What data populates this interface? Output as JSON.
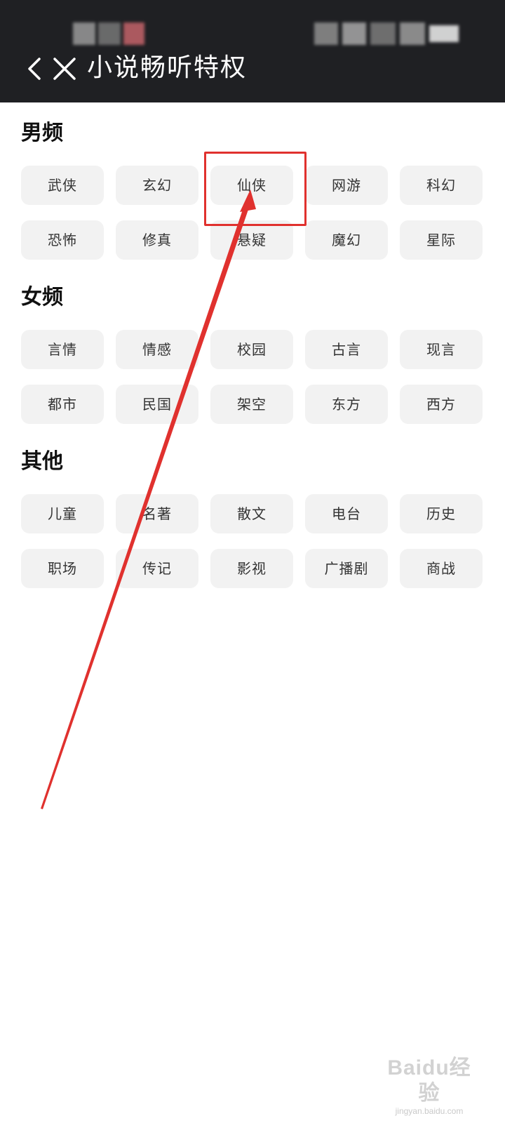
{
  "header": {
    "title": "小说畅听特权",
    "back_icon": "chevron-left-icon",
    "close_icon": "close-icon",
    "background": "#1f2023"
  },
  "sections": [
    {
      "title": "男频",
      "tags": [
        "武侠",
        "玄幻",
        "仙侠",
        "网游",
        "科幻",
        "恐怖",
        "修真",
        "悬疑",
        "魔幻",
        "星际"
      ]
    },
    {
      "title": "女频",
      "tags": [
        "言情",
        "情感",
        "校园",
        "古言",
        "现言",
        "都市",
        "民国",
        "架空",
        "东方",
        "西方"
      ]
    },
    {
      "title": "其他",
      "tags": [
        "儿童",
        "名著",
        "散文",
        "电台",
        "历史",
        "职场",
        "传记",
        "影视",
        "广播剧",
        "商战"
      ]
    }
  ],
  "annotation": {
    "highlighted_tag": "仙侠",
    "color": "#e0312e"
  },
  "watermark": {
    "logo": "Baidu经验",
    "site": "jingyan.baidu.com"
  }
}
